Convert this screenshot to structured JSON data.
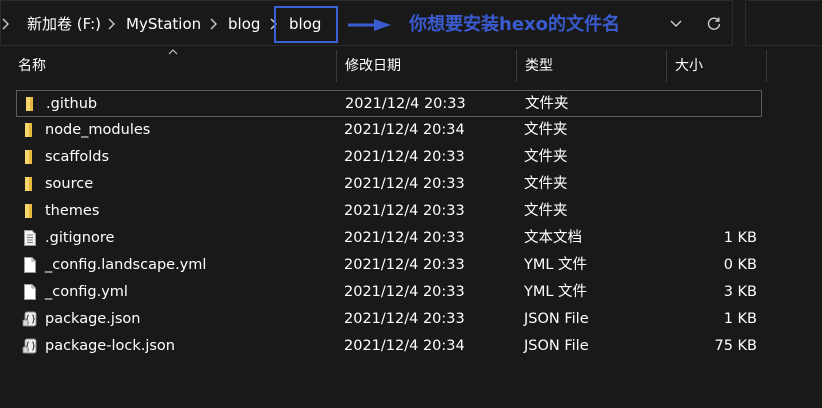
{
  "address_bar": {
    "breadcrumbs": [
      "新加卷 (F:)",
      "MyStation",
      "blog",
      "blog"
    ]
  },
  "annotation": {
    "text": "你想要安装hexo的文件名",
    "color": "#3a5bd0"
  },
  "columns": {
    "name": "名称",
    "date": "修改日期",
    "type": "类型",
    "size": "大小"
  },
  "files": [
    {
      "name": ".github",
      "date": "2021/12/4 20:33",
      "type": "文件夹",
      "size": "",
      "icon": "folder-icon"
    },
    {
      "name": "node_modules",
      "date": "2021/12/4 20:34",
      "type": "文件夹",
      "size": "",
      "icon": "folder-icon"
    },
    {
      "name": "scaffolds",
      "date": "2021/12/4 20:33",
      "type": "文件夹",
      "size": "",
      "icon": "folder-icon"
    },
    {
      "name": "source",
      "date": "2021/12/4 20:33",
      "type": "文件夹",
      "size": "",
      "icon": "folder-icon"
    },
    {
      "name": "themes",
      "date": "2021/12/4 20:33",
      "type": "文件夹",
      "size": "",
      "icon": "folder-icon"
    },
    {
      "name": ".gitignore",
      "date": "2021/12/4 20:33",
      "type": "文本文档",
      "size": "1 KB",
      "icon": "text-file-icon"
    },
    {
      "name": "_config.landscape.yml",
      "date": "2021/12/4 20:33",
      "type": "YML 文件",
      "size": "0 KB",
      "icon": "file-icon"
    },
    {
      "name": "_config.yml",
      "date": "2021/12/4 20:33",
      "type": "YML 文件",
      "size": "3 KB",
      "icon": "file-icon"
    },
    {
      "name": "package.json",
      "date": "2021/12/4 20:33",
      "type": "JSON File",
      "size": "1 KB",
      "icon": "json-file-icon"
    },
    {
      "name": "package-lock.json",
      "date": "2021/12/4 20:34",
      "type": "JSON File",
      "size": "75 KB",
      "icon": "json-file-icon"
    }
  ]
}
